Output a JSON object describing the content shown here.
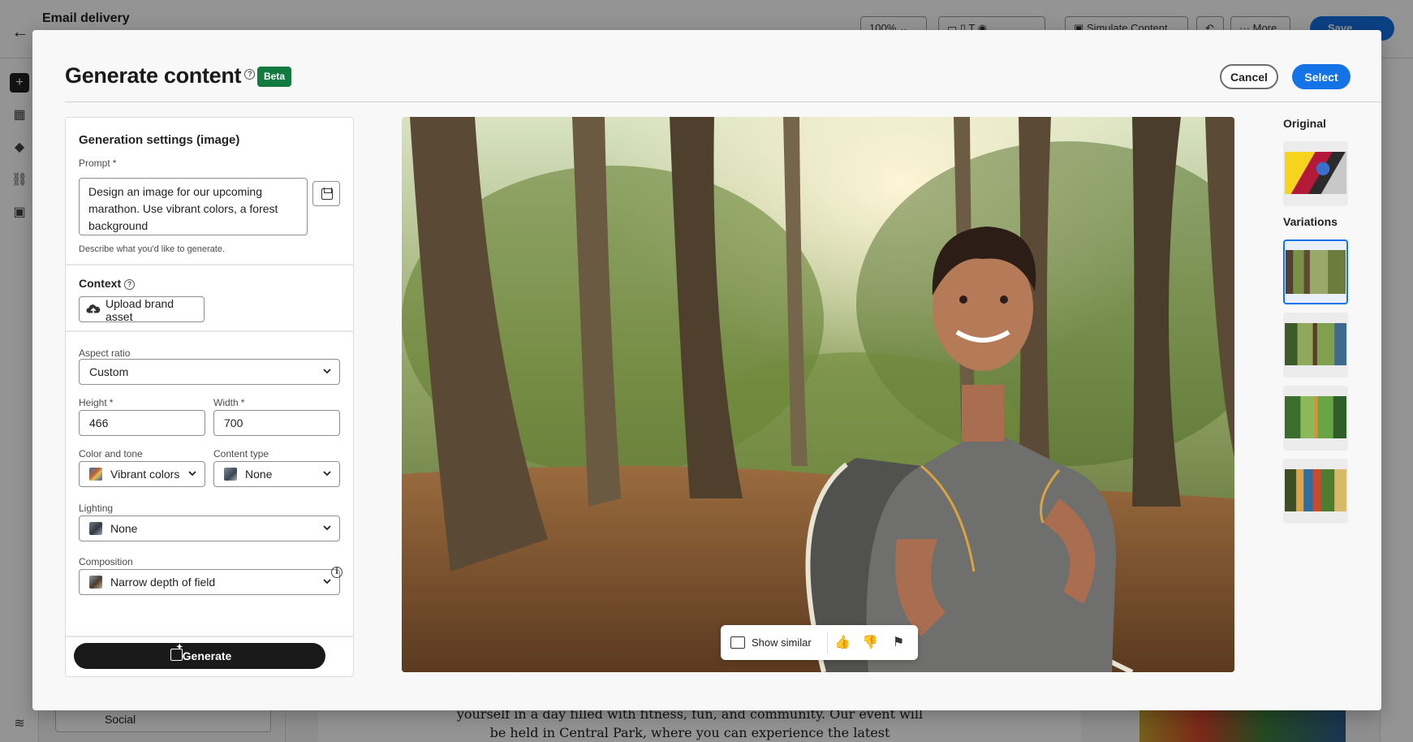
{
  "background": {
    "title": "Email delivery",
    "zoom": "100%",
    "simulate_label": "Simulate Content",
    "more_label": "More",
    "save_label": "Save",
    "social_label": "Social",
    "canvas_text": "yourself in a day filled with fitness, fun, and community. Our event will be held in Central Park, where you can experience the latest"
  },
  "modal": {
    "title": "Generate content",
    "badge": "Beta",
    "cancel_label": "Cancel",
    "select_label": "Select"
  },
  "settings": {
    "section_title": "Generation settings (image)",
    "prompt": {
      "label": "Prompt",
      "required_mark": "*",
      "value": "Design an image for our upcoming marathon. Use vibrant colors, a forest background",
      "hint": "Describe what you'd like to generate."
    },
    "context": {
      "title": "Context",
      "upload_label": "Upload brand asset"
    },
    "aspect_ratio": {
      "label": "Aspect ratio",
      "value": "Custom"
    },
    "height": {
      "label": "Height",
      "value": "466"
    },
    "width": {
      "label": "Width",
      "value": "700"
    },
    "color_tone": {
      "label": "Color and tone",
      "value": "Vibrant colors"
    },
    "content_type": {
      "label": "Content type",
      "value": "None"
    },
    "lighting": {
      "label": "Lighting",
      "value": "None"
    },
    "composition": {
      "label": "Composition",
      "value": "Narrow depth of field"
    },
    "generate_label": "Generate"
  },
  "preview": {
    "show_similar_label": "Show similar",
    "actions": [
      "thumbs-up-icon",
      "thumbs-down-icon",
      "flag-icon"
    ]
  },
  "sidebar": {
    "original_label": "Original",
    "variations_label": "Variations",
    "variations_count": 4,
    "selected_variation": 1
  },
  "colors": {
    "accent": "#1473e6",
    "beta_badge": "#117a3f",
    "generate_button": "#1a1a1a"
  }
}
